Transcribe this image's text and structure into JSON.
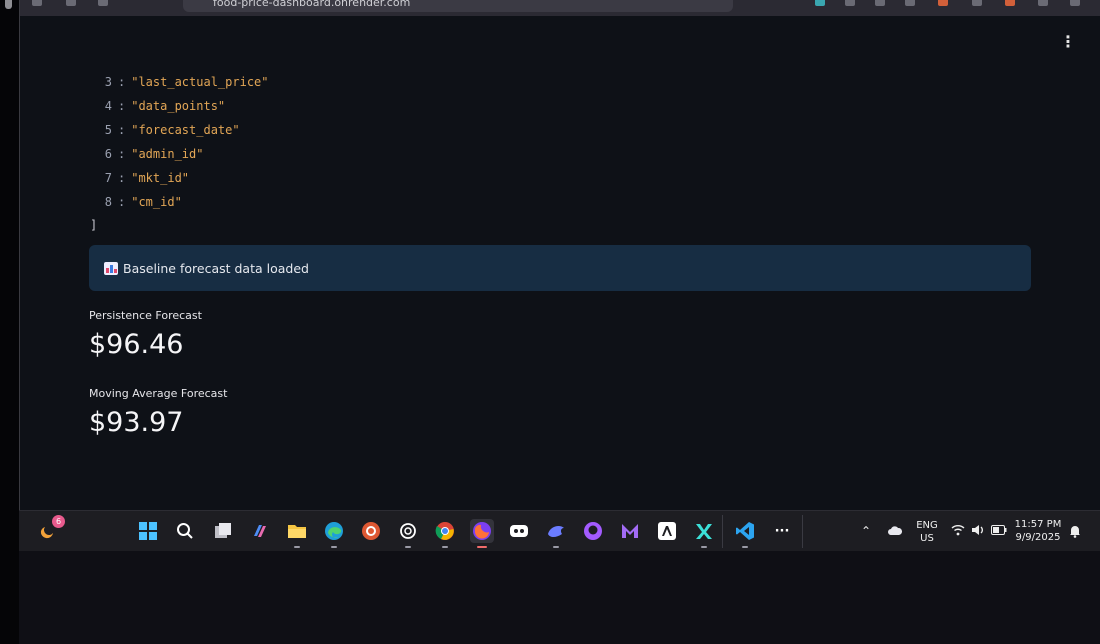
{
  "browser": {
    "url": "food-price-dashboard.onrender.com"
  },
  "json_view": {
    "rows": [
      {
        "index": "3",
        "value": "\"last_actual_price\""
      },
      {
        "index": "4",
        "value": "\"data_points\""
      },
      {
        "index": "5",
        "value": "\"forecast_date\""
      },
      {
        "index": "6",
        "value": "\"admin_id\""
      },
      {
        "index": "7",
        "value": "\"mkt_id\""
      },
      {
        "index": "8",
        "value": "\"cm_id\""
      }
    ],
    "closing_bracket": "]"
  },
  "alert": {
    "text": "Baseline forecast data loaded",
    "icon": "bar-chart-icon"
  },
  "metrics": [
    {
      "label": "Persistence Forecast",
      "value": "$96.46"
    },
    {
      "label": "Moving Average Forecast",
      "value": "$93.97"
    }
  ],
  "taskbar": {
    "start_badge": "6",
    "language_top": "ENG",
    "language_bottom": "US",
    "time": "11:57 PM",
    "date": "9/9/2025",
    "overflow": "···"
  },
  "colors": {
    "app_background": "#0e1117",
    "alert_background": "#172d43",
    "json_value": "#e2a656"
  }
}
